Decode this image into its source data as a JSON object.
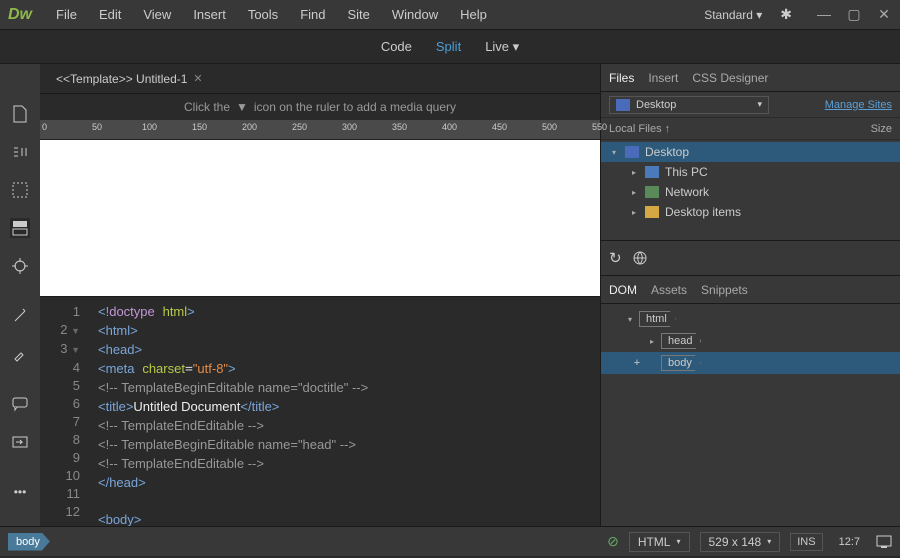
{
  "app": {
    "logo": "Dw"
  },
  "menu": [
    "File",
    "Edit",
    "View",
    "Insert",
    "Tools",
    "Find",
    "Site",
    "Window",
    "Help"
  ],
  "workspace": "Standard",
  "views": {
    "code": "Code",
    "split": "Split",
    "live": "Live"
  },
  "tab": {
    "title": "<<Template>> Untitled-1"
  },
  "mqhint": {
    "pre": "Click the",
    "post": "icon on the ruler to add a media query"
  },
  "ruler": [
    "0",
    "50",
    "100",
    "150",
    "200",
    "250",
    "300",
    "350",
    "400",
    "450",
    "500",
    "550"
  ],
  "code": {
    "lines": [
      1,
      2,
      3,
      4,
      5,
      6,
      7,
      8,
      9,
      10,
      11,
      12
    ]
  },
  "status": {
    "path": "body",
    "lang": "HTML",
    "dims": "529 x 148",
    "ins": "INS",
    "pos": "12:7"
  },
  "filesPanel": {
    "tabs": [
      "Files",
      "Insert",
      "CSS Designer"
    ],
    "dropdown": "Desktop",
    "manage": "Manage Sites",
    "cols": {
      "a": "Local Files ↑",
      "b": "Size"
    },
    "tree": [
      {
        "label": "Desktop",
        "icon": "mon",
        "indent": 0,
        "expand": "down",
        "sel": true
      },
      {
        "label": "This PC",
        "icon": "pc",
        "indent": 1,
        "expand": "right"
      },
      {
        "label": "Network",
        "icon": "net",
        "indent": 1,
        "expand": "right"
      },
      {
        "label": "Desktop items",
        "icon": "folder",
        "indent": 1,
        "expand": "right"
      }
    ]
  },
  "domPanel": {
    "tabs": [
      "DOM",
      "Assets",
      "Snippets"
    ],
    "nodes": [
      {
        "tag": "html",
        "indent": 0,
        "expand": "down"
      },
      {
        "tag": "head",
        "indent": 1,
        "expand": "right"
      },
      {
        "tag": "body",
        "indent": 1,
        "sel": true,
        "add": true
      }
    ]
  }
}
